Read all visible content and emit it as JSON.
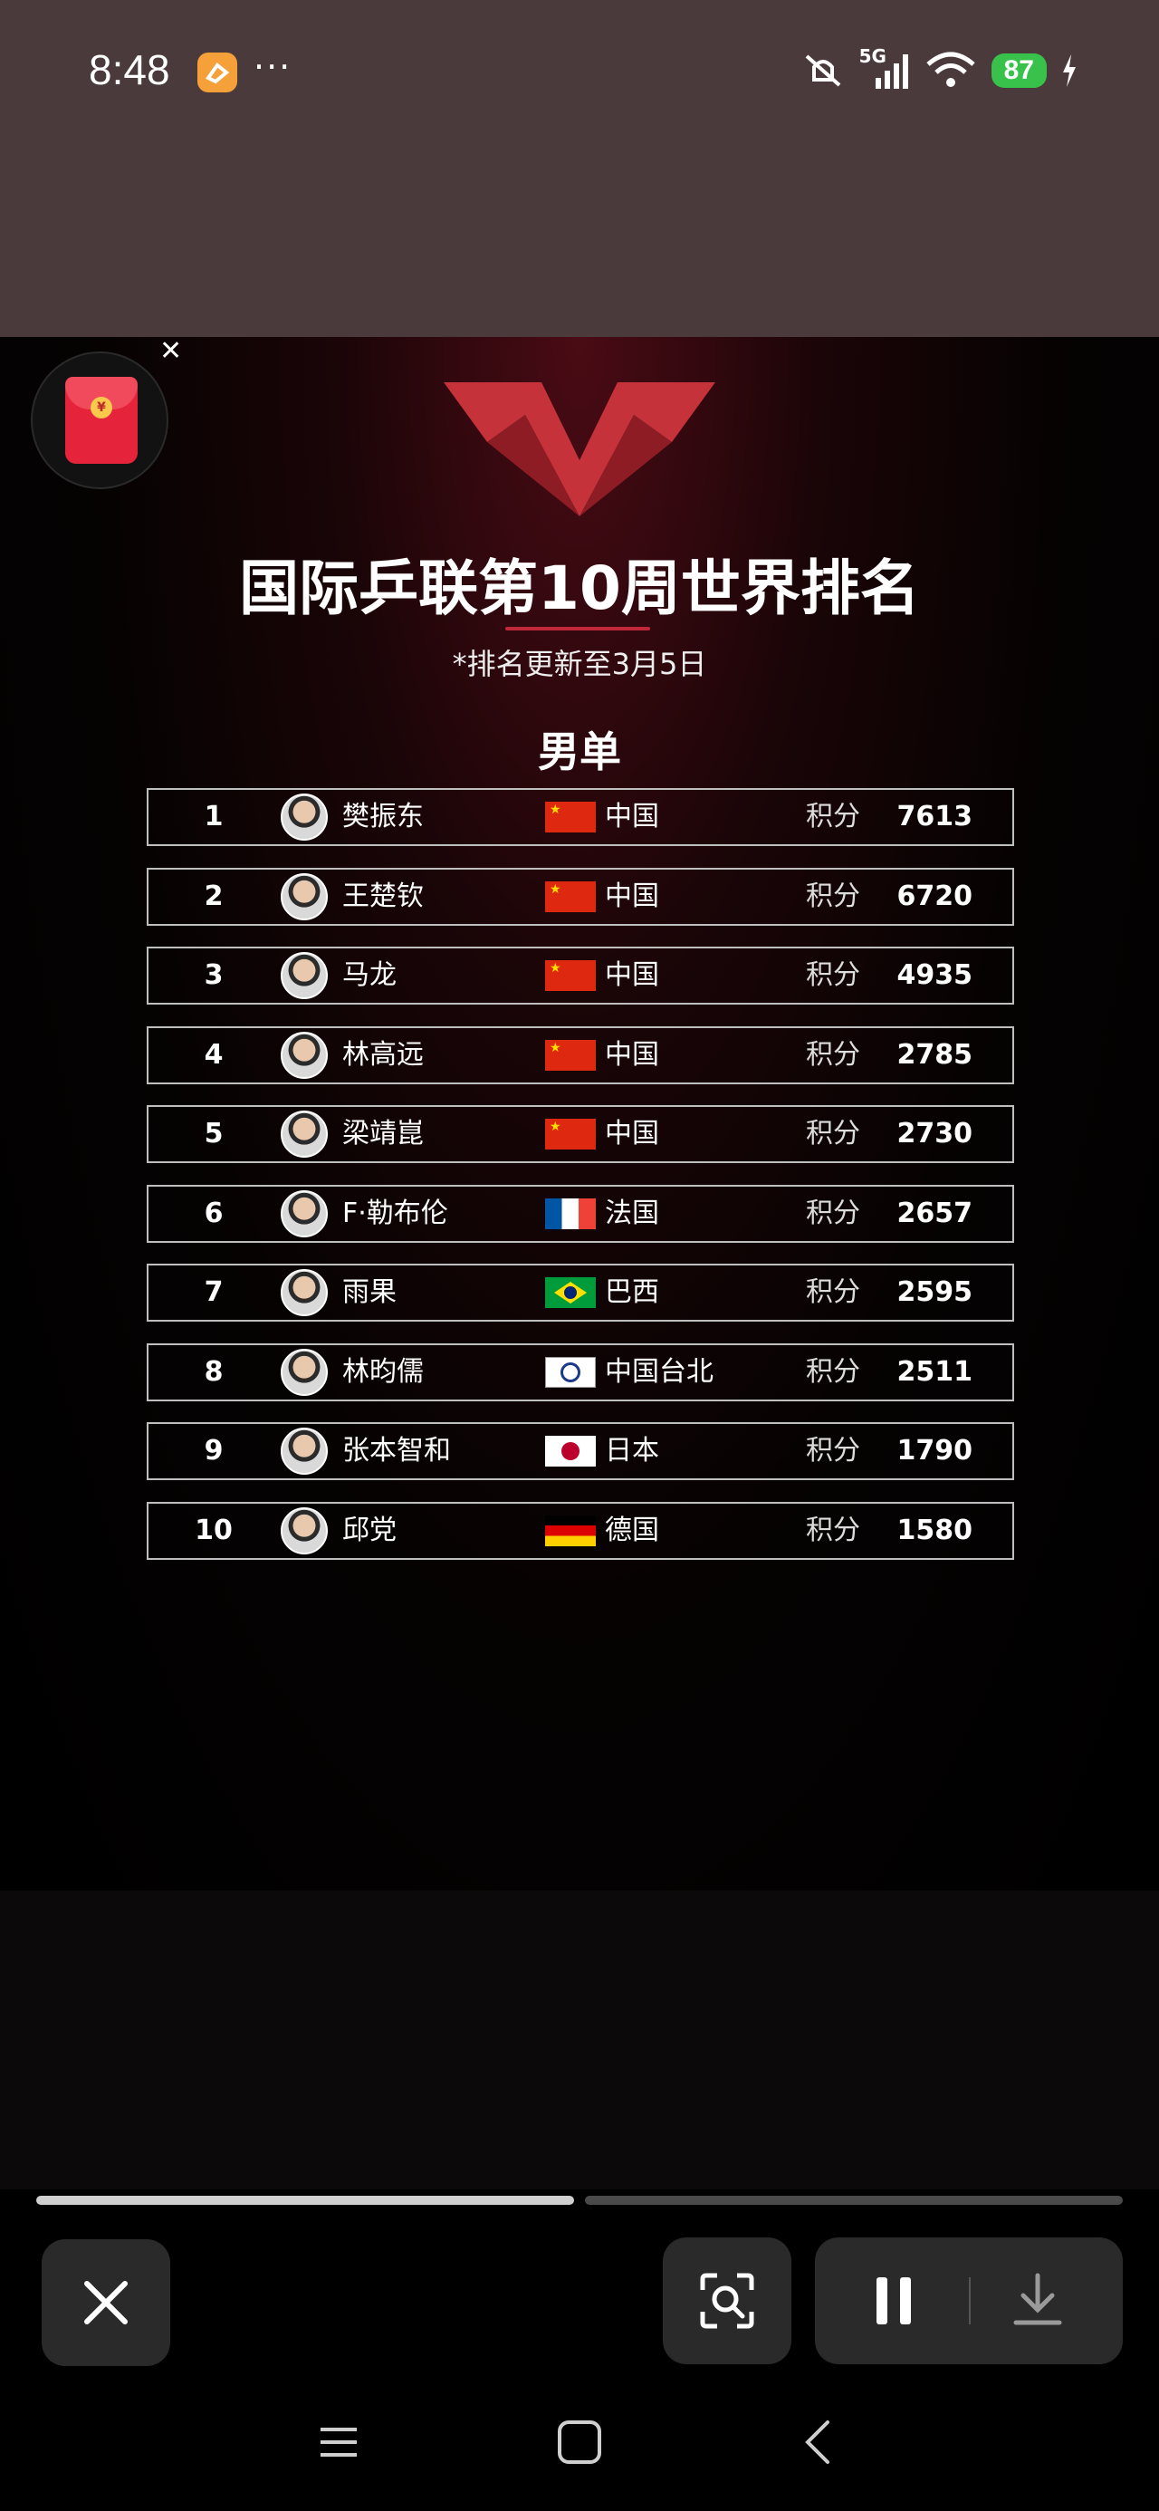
{
  "status_bar": {
    "time": "8:48",
    "dots": "···",
    "network": "5G",
    "battery": "87"
  },
  "poster": {
    "title": "国际乒联第10周世界排名",
    "subtitle": "*排名更新至3月5日",
    "section": "男单",
    "points_label": "积分",
    "rankings": [
      {
        "rank": "1",
        "name": "樊振东",
        "country": "中国",
        "flag": "cn",
        "points": "7613"
      },
      {
        "rank": "2",
        "name": "王楚钦",
        "country": "中国",
        "flag": "cn",
        "points": "6720"
      },
      {
        "rank": "3",
        "name": "马龙",
        "country": "中国",
        "flag": "cn",
        "points": "4935"
      },
      {
        "rank": "4",
        "name": "林高远",
        "country": "中国",
        "flag": "cn",
        "points": "2785"
      },
      {
        "rank": "5",
        "name": "梁靖崑",
        "country": "中国",
        "flag": "cn",
        "points": "2730"
      },
      {
        "rank": "6",
        "name": "F·勒布伦",
        "country": "法国",
        "flag": "fr",
        "points": "2657"
      },
      {
        "rank": "7",
        "name": "雨果",
        "country": "巴西",
        "flag": "br",
        "points": "2595"
      },
      {
        "rank": "8",
        "name": "林昀儒",
        "country": "中国台北",
        "flag": "tpe",
        "points": "2511"
      },
      {
        "rank": "9",
        "name": "张本智和",
        "country": "日本",
        "flag": "jp",
        "points": "1790"
      },
      {
        "rank": "10",
        "name": "邱党",
        "country": "德国",
        "flag": "de",
        "points": "1580"
      }
    ]
  },
  "red_packet": {
    "coin": "¥"
  },
  "progress": {
    "segments": 2,
    "current": 1
  },
  "icons": [
    "red-packet-icon",
    "close-icon",
    "scan-icon",
    "pause-icon",
    "download-icon",
    "menu-icon",
    "home-icon",
    "back-icon"
  ],
  "colors": {
    "status_bg": "#4b3a3b",
    "accent_red": "#c0283a",
    "battery_green": "#39c24b"
  }
}
